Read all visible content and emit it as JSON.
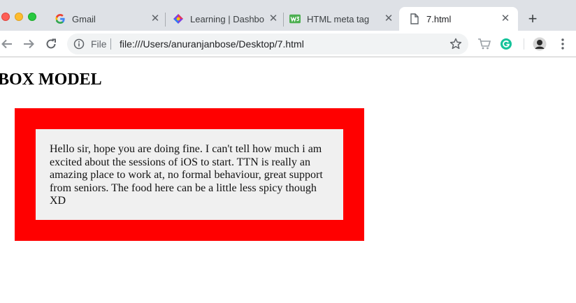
{
  "browser": {
    "tabs": [
      {
        "title": "Gmail",
        "icon": "gmail-google-icon",
        "active": false
      },
      {
        "title": "Learning | Dashbo",
        "icon": "learning-dashboard-icon",
        "active": false
      },
      {
        "title": "HTML meta tag",
        "icon": "w3schools-icon",
        "active": false
      },
      {
        "title": "7.html",
        "icon": "file-icon",
        "active": true
      }
    ],
    "new_tab_label": "+",
    "tab_close_label": "✕",
    "address_bar": {
      "scheme_label": "File",
      "url": "file:///Users/anuranjanbose/Desktop/7.html"
    },
    "colors": {
      "tabstrip": "#dee1e6",
      "toolbar": "#ffffff",
      "omnibox": "#f1f3f4"
    }
  },
  "page": {
    "heading": "BOX MODEL",
    "box_text": "Hello sir, hope you are doing fine. I can't tell how much i am excited about the sessions of iOS to start. TTN is really an amazing place to work at, no formal behaviour, great support from seniors. The food here can be a little less spicy though XD",
    "colors": {
      "outer_box": "#ff0000",
      "inner_box": "#f0f0f0"
    }
  }
}
